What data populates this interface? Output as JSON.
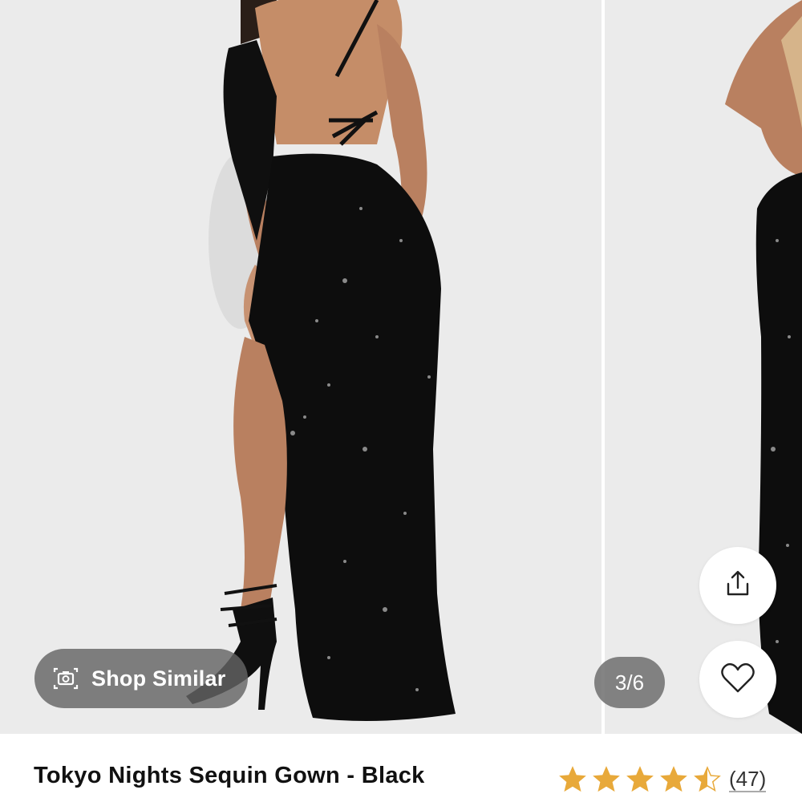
{
  "gallery": {
    "counter": "3/6",
    "shop_similar_label": "Shop Similar",
    "share_icon": "share-icon",
    "favorite_icon": "heart-icon",
    "camera_icon": "camera-icon"
  },
  "product": {
    "title": "Tokyo Nights Sequin Gown - Black",
    "rating": {
      "value": 4.5,
      "max": 5,
      "count_label": "(47)",
      "star_color": "#e8a93a"
    }
  },
  "colors": {
    "backdrop": "#ebebeb",
    "dress": "#0d0d0d",
    "overlay_pill": "#646464"
  }
}
